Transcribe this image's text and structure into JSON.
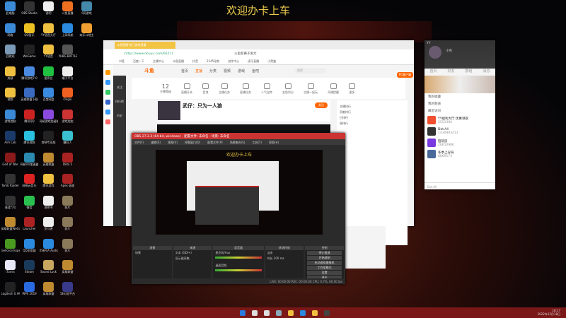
{
  "wallpaper": {
    "title": "欢迎办卡上车"
  },
  "desktop_icons": [
    {
      "label": "此电脑",
      "color": "#3a8ad8"
    },
    {
      "label": "OBS Studio",
      "color": "#333"
    },
    {
      "label": "说明",
      "color": "#eee"
    },
    {
      "label": "斗鱼直播",
      "color": "#f07020"
    },
    {
      "label": "QQ游戏",
      "color": "#48a"
    },
    {
      "label": "网络",
      "color": "#3a8ad8"
    },
    {
      "label": "QQ音乐",
      "color": "#ecc020"
    },
    {
      "label": "YY语音大厅",
      "color": "#f0c040"
    },
    {
      "label": "上网导航",
      "color": "#2a8ae0"
    },
    {
      "label": "欢乐斗地主",
      "color": "#f0a030"
    },
    {
      "label": "回收站",
      "color": "#7a9ab8"
    },
    {
      "label": "WeGame",
      "color": "#222"
    },
    {
      "label": "YY语音",
      "color": "#f0c040"
    },
    {
      "label": "PUBG BATTLEGR...",
      "color": "#555"
    },
    {
      "label": "",
      "color": "transparent"
    },
    {
      "label": "成绩",
      "color": "#f0c040"
    },
    {
      "label": "腾讯游戏7.0",
      "color": "#4a8ae0"
    },
    {
      "label": "爱奇艺",
      "color": "#20c040"
    },
    {
      "label": "橘子平台",
      "color": "#eee"
    },
    {
      "label": "",
      "color": "transparent"
    },
    {
      "label": "视频",
      "color": "#f0c040"
    },
    {
      "label": "英雄联盟下载",
      "color": "#3a6ac0"
    },
    {
      "label": "百度网盘",
      "color": "#3a8ae0"
    },
    {
      "label": "Origin",
      "color": "#f06020"
    },
    {
      "label": "",
      "color": "transparent"
    },
    {
      "label": "游戏控制",
      "color": "#3a8ad8"
    },
    {
      "label": "腾讯QQ",
      "color": "#c22"
    },
    {
      "label": "网易游戏加速助手",
      "color": "#8a4ae0"
    },
    {
      "label": "游戏加加",
      "color": "#c33"
    },
    {
      "label": "",
      "color": "transparent"
    },
    {
      "label": "Aim Lab",
      "color": "#1a3a6a"
    },
    {
      "label": "腾讯视频",
      "color": "#2ac0e0"
    },
    {
      "label": "剪映专业版",
      "color": "#222"
    },
    {
      "label": "糖豆人",
      "color": "#3ac0d0"
    },
    {
      "label": "",
      "color": "transparent"
    },
    {
      "label": "God of War",
      "color": "#8a1a1a"
    },
    {
      "label": "网易UU加速器",
      "color": "#2a8ab0"
    },
    {
      "label": "英雄联盟",
      "color": "#c08a30"
    },
    {
      "label": "Dota 2",
      "color": "#a22"
    },
    {
      "label": "",
      "color": "transparent"
    },
    {
      "label": "Tomb Raider",
      "color": "#333"
    },
    {
      "label": "网易云音乐",
      "color": "#d22"
    },
    {
      "label": "腾讯游戏",
      "color": "#f0c040"
    },
    {
      "label": "Apex 英雄",
      "color": "#a22"
    },
    {
      "label": "",
      "color": "transparent"
    },
    {
      "label": "海战六号",
      "color": "#333"
    },
    {
      "label": "微信",
      "color": "#2ac050"
    },
    {
      "label": "说明书",
      "color": "#eee"
    },
    {
      "label": "照片",
      "color": "#8a7a5a"
    },
    {
      "label": "",
      "color": "transparent"
    },
    {
      "label": "英雄联盟WeGame版",
      "color": "#c08a30"
    },
    {
      "label": "Launcher",
      "color": "#a22"
    },
    {
      "label": "亚马逊",
      "color": "#eee"
    },
    {
      "label": "照片",
      "color": "#8a7a5a"
    },
    {
      "label": "",
      "color": "transparent"
    },
    {
      "label": "GeForce Experience",
      "color": "#4a9a20"
    },
    {
      "label": "QQ浏览器",
      "color": "#2a8ae0"
    },
    {
      "label": "XSERIA Audio",
      "color": "#2a8ae0"
    },
    {
      "label": "照片",
      "color": "#8a7a5a"
    },
    {
      "label": "",
      "color": "transparent"
    },
    {
      "label": "iTunes",
      "color": "#e8e8f8"
    },
    {
      "label": "Steam",
      "color": "#1a3a5a"
    },
    {
      "label": "Sound Lock",
      "color": "#c8a860"
    },
    {
      "label": "英雄联盟",
      "color": "#c08a30"
    },
    {
      "label": "",
      "color": "transparent"
    },
    {
      "label": "Logitech G HUB",
      "color": "#222"
    },
    {
      "label": "WPS 2019",
      "color": "#2a6ae0"
    },
    {
      "label": "英雄联盟",
      "color": "#c08a30"
    },
    {
      "label": "5E对战平台",
      "color": "#3a3a8a"
    },
    {
      "label": "",
      "color": "transparent"
    }
  ],
  "browser": {
    "tab": "斗鱼直播-热门游戏直播",
    "url": "https://www.douyu.com/66211",
    "search_hint": "斗鱼新赛子发文",
    "bookmarks": [
      "书签",
      "百度一下",
      "主播中心",
      "斗鱼直播",
      "抖音",
      "2345导航",
      "创作中心",
      "虎牙直播",
      "小黑盒"
    ],
    "logo": "斗鱼",
    "nav": [
      "首页",
      "直播",
      "分类",
      "视频",
      "游戏",
      "鱼吧"
    ],
    "search_placeholder": "搜索",
    "quick": [
      {
        "value": "12",
        "label": "主播等级"
      },
      {
        "label": "直播开关"
      },
      {
        "label": "音浪"
      },
      {
        "label": "主播任务"
      },
      {
        "label": "直播任务"
      },
      {
        "label": "人气宝库"
      },
      {
        "label": "金鱼积分"
      },
      {
        "label": "主播一起玩"
      },
      {
        "label": "开播提醒"
      },
      {
        "label": "更多"
      }
    ],
    "pc_client": "PC客户端",
    "streamer_name": "武仔：只为一人狼",
    "follow": "关注",
    "side_links": [
      "主播排行",
      "贡献排行",
      "日排行",
      "周排行"
    ],
    "left_nav": [
      "关注",
      "排行榜",
      "历史"
    ]
  },
  "obs": {
    "title": "OBS 27.2.3 (64-bit, windows) - 配置文件: 未命名 - 场景: 未命名",
    "menu": [
      "文件(F)",
      "编辑(E)",
      "视图(V)",
      "停靠窗口(D)",
      "配置文件(P)",
      "场景集合(S)",
      "工具(T)",
      "帮助(H)"
    ],
    "preview_title": "欢迎办卡上车",
    "docks": {
      "scenes": "场景",
      "sources": "来源",
      "mixer": "混音器",
      "transitions": "转场特效",
      "controls": "控制"
    },
    "scene_items": [
      "场景"
    ],
    "source_items": [
      "文本 (GDI+)",
      "显示器采集"
    ],
    "mixer_tracks": [
      "麦克风/Aux",
      "桌面音频"
    ],
    "transition": "淡出",
    "duration_label": "时长",
    "duration": "300 ms",
    "controls": [
      "停止推流",
      "开始录制",
      "启动虚拟摄像机",
      "工作室模式",
      "设置",
      "退出"
    ],
    "status": "LIVE: 00:00:00  REC: 00:00:00  CPU: 0.7%, 60.00 fps"
  },
  "yy": {
    "app": "YY",
    "name": "小鸟",
    "tabs": [
      "首页",
      "好友",
      "群组",
      "消息"
    ],
    "sections": [
      "我的收藏",
      "我的频道",
      "最近访问"
    ],
    "items": [
      {
        "name": "YY福利大厅 优惠领取",
        "id": "2551384",
        "color": "#f05030"
      },
      {
        "name": "Dot.Ali",
        "id": "1430993411",
        "color": "#333"
      },
      {
        "name": "陪玩房",
        "id": "28610986",
        "color": "#7a3ae0"
      },
      {
        "name": "冬季上分局",
        "id": "8869173",
        "color": "#4a6a9a"
      }
    ],
    "bottom": "Dot.Ali"
  },
  "taskbar": {
    "icons": [
      "#2a7ae0",
      "#ddd",
      "#ddd",
      "#8ab",
      "#f0c040",
      "#2a8ae0",
      "#f0c040",
      "#444"
    ],
    "time": "18:17",
    "date": "2022年12月18日"
  }
}
